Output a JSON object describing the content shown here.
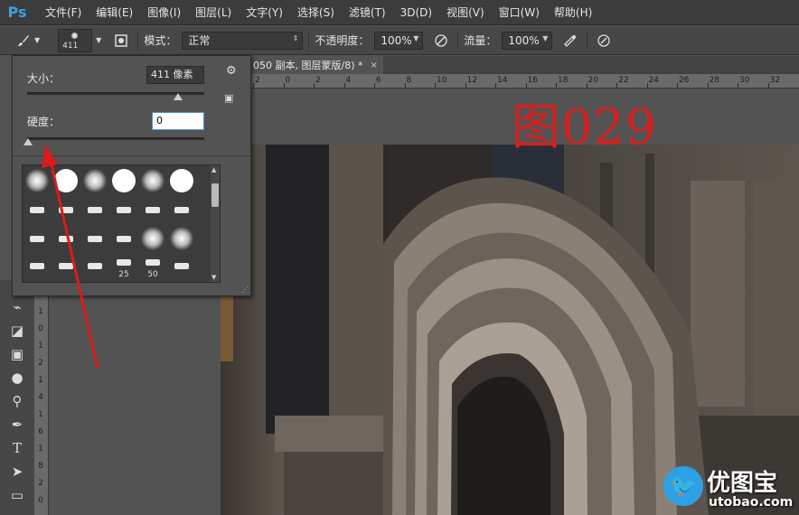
{
  "app": {
    "logo": "Ps"
  },
  "menu": [
    "文件(F)",
    "编辑(E)",
    "图像(I)",
    "图层(L)",
    "文字(Y)",
    "选择(S)",
    "滤镜(T)",
    "3D(D)",
    "视图(V)",
    "窗口(W)",
    "帮助(H)"
  ],
  "options": {
    "brush_size_label": "411",
    "mode_label": "模式：",
    "mode_value": "正常",
    "opacity_label": "不透明度：",
    "opacity_value": "100%",
    "flow_label": "流量：",
    "flow_value": "100%"
  },
  "document_tab": {
    "title": "050 副本, 图层蒙版/8) *",
    "close": "×"
  },
  "ruler": {
    "h_ticks": [
      "2",
      "0",
      "2",
      "4",
      "6",
      "8",
      "10",
      "12",
      "14",
      "16",
      "18",
      "20",
      "22",
      "24",
      "26",
      "28",
      "30",
      "32"
    ],
    "v_ticks": [
      "1",
      "0",
      "1",
      "2",
      "1",
      "4",
      "1",
      "6",
      "1",
      "8",
      "2",
      "0"
    ]
  },
  "brush_popup": {
    "size_label": "大小：",
    "size_value": "411 像素",
    "hardness_label": "硬度：",
    "hardness_value": "0",
    "brush_numbers": [
      "25",
      "50"
    ]
  },
  "annotation": {
    "text": "图029",
    "color": "#d62020"
  },
  "watermark": {
    "brand": "优图宝",
    "url": "utobao.com"
  },
  "colors": {
    "menubar": "#3c3c3c",
    "panel": "#535353",
    "accent": "#2ea1e6",
    "arrow": "#d91c1c"
  }
}
